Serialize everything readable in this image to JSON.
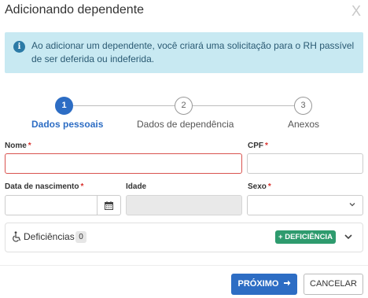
{
  "modal": {
    "title": "Adicionando dependente",
    "close_label": "X"
  },
  "info": {
    "icon": "info-icon",
    "icon_glyph": "i",
    "text": "Ao adicionar um dependente, você criará uma solicitação para o RH passível de ser deferida ou indeferida."
  },
  "stepper": {
    "steps": [
      {
        "number": "1",
        "label": "Dados pessoais",
        "active": true
      },
      {
        "number": "2",
        "label": "Dados de dependência",
        "active": false
      },
      {
        "number": "3",
        "label": "Anexos",
        "active": false
      }
    ]
  },
  "form": {
    "nome": {
      "label": "Nome",
      "required_mark": "*",
      "value": ""
    },
    "cpf": {
      "label": "CPF",
      "required_mark": "*",
      "value": ""
    },
    "data_nascimento": {
      "label": "Data de nascimento",
      "required_mark": "*",
      "value": ""
    },
    "idade": {
      "label": "Idade",
      "value": ""
    },
    "sexo": {
      "label": "Sexo",
      "required_mark": "*",
      "selected": ""
    }
  },
  "deficiencias": {
    "label": "Deficiências",
    "count": "0",
    "add_button": "+ DEFICIÊNCIA"
  },
  "footer": {
    "next_label": "PRÓXIMO",
    "cancel_label": "CANCELAR"
  },
  "colors": {
    "primary": "#2d6dc4",
    "success": "#2e9b6e",
    "info_bg": "#c8e9f2",
    "required": "#d9302c"
  }
}
